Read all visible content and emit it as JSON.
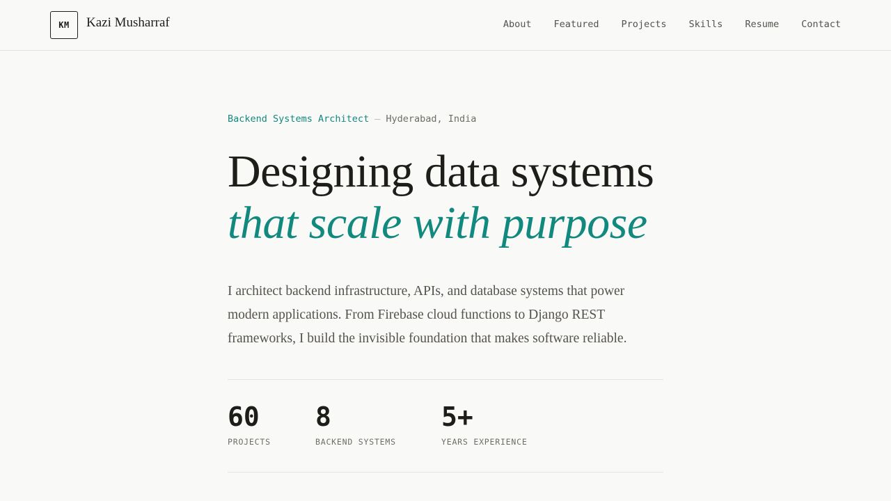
{
  "header": {
    "logo_initials": "KM",
    "logo_name": "Kazi Musharraf",
    "nav": [
      "About",
      "Featured",
      "Projects",
      "Skills",
      "Resume",
      "Contact"
    ]
  },
  "hero": {
    "role": "Backend Systems Architect",
    "separator": "—",
    "location": "Hyderabad, India",
    "headline": "Designing data systems",
    "headline_accent": "that scale with purpose",
    "intro": "I architect backend infrastructure, APIs, and database systems that power modern applications. From Firebase cloud functions to Django REST frameworks, I build the invisible foundation that makes software reliable."
  },
  "stats": [
    {
      "value": "60",
      "label": "PROJECTS"
    },
    {
      "value": "8",
      "label": "BACKEND SYSTEMS"
    },
    {
      "value": "5+",
      "label": "YEARS EXPERIENCE"
    }
  ],
  "colors": {
    "accent": "#12897f",
    "background": "#f9f9f7",
    "text": "#1f1d1a"
  }
}
